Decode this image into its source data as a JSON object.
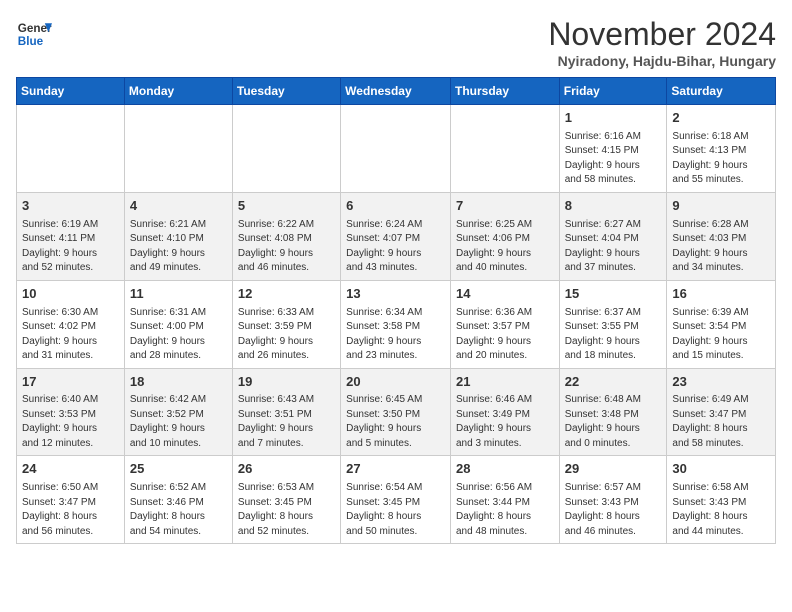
{
  "logo": {
    "line1": "General",
    "line2": "Blue"
  },
  "title": "November 2024",
  "location": "Nyiradony, Hajdu-Bihar, Hungary",
  "days_header": [
    "Sunday",
    "Monday",
    "Tuesday",
    "Wednesday",
    "Thursday",
    "Friday",
    "Saturday"
  ],
  "weeks": [
    [
      {
        "day": "",
        "info": ""
      },
      {
        "day": "",
        "info": ""
      },
      {
        "day": "",
        "info": ""
      },
      {
        "day": "",
        "info": ""
      },
      {
        "day": "",
        "info": ""
      },
      {
        "day": "1",
        "info": "Sunrise: 6:16 AM\nSunset: 4:15 PM\nDaylight: 9 hours\nand 58 minutes."
      },
      {
        "day": "2",
        "info": "Sunrise: 6:18 AM\nSunset: 4:13 PM\nDaylight: 9 hours\nand 55 minutes."
      }
    ],
    [
      {
        "day": "3",
        "info": "Sunrise: 6:19 AM\nSunset: 4:11 PM\nDaylight: 9 hours\nand 52 minutes."
      },
      {
        "day": "4",
        "info": "Sunrise: 6:21 AM\nSunset: 4:10 PM\nDaylight: 9 hours\nand 49 minutes."
      },
      {
        "day": "5",
        "info": "Sunrise: 6:22 AM\nSunset: 4:08 PM\nDaylight: 9 hours\nand 46 minutes."
      },
      {
        "day": "6",
        "info": "Sunrise: 6:24 AM\nSunset: 4:07 PM\nDaylight: 9 hours\nand 43 minutes."
      },
      {
        "day": "7",
        "info": "Sunrise: 6:25 AM\nSunset: 4:06 PM\nDaylight: 9 hours\nand 40 minutes."
      },
      {
        "day": "8",
        "info": "Sunrise: 6:27 AM\nSunset: 4:04 PM\nDaylight: 9 hours\nand 37 minutes."
      },
      {
        "day": "9",
        "info": "Sunrise: 6:28 AM\nSunset: 4:03 PM\nDaylight: 9 hours\nand 34 minutes."
      }
    ],
    [
      {
        "day": "10",
        "info": "Sunrise: 6:30 AM\nSunset: 4:02 PM\nDaylight: 9 hours\nand 31 minutes."
      },
      {
        "day": "11",
        "info": "Sunrise: 6:31 AM\nSunset: 4:00 PM\nDaylight: 9 hours\nand 28 minutes."
      },
      {
        "day": "12",
        "info": "Sunrise: 6:33 AM\nSunset: 3:59 PM\nDaylight: 9 hours\nand 26 minutes."
      },
      {
        "day": "13",
        "info": "Sunrise: 6:34 AM\nSunset: 3:58 PM\nDaylight: 9 hours\nand 23 minutes."
      },
      {
        "day": "14",
        "info": "Sunrise: 6:36 AM\nSunset: 3:57 PM\nDaylight: 9 hours\nand 20 minutes."
      },
      {
        "day": "15",
        "info": "Sunrise: 6:37 AM\nSunset: 3:55 PM\nDaylight: 9 hours\nand 18 minutes."
      },
      {
        "day": "16",
        "info": "Sunrise: 6:39 AM\nSunset: 3:54 PM\nDaylight: 9 hours\nand 15 minutes."
      }
    ],
    [
      {
        "day": "17",
        "info": "Sunrise: 6:40 AM\nSunset: 3:53 PM\nDaylight: 9 hours\nand 12 minutes."
      },
      {
        "day": "18",
        "info": "Sunrise: 6:42 AM\nSunset: 3:52 PM\nDaylight: 9 hours\nand 10 minutes."
      },
      {
        "day": "19",
        "info": "Sunrise: 6:43 AM\nSunset: 3:51 PM\nDaylight: 9 hours\nand 7 minutes."
      },
      {
        "day": "20",
        "info": "Sunrise: 6:45 AM\nSunset: 3:50 PM\nDaylight: 9 hours\nand 5 minutes."
      },
      {
        "day": "21",
        "info": "Sunrise: 6:46 AM\nSunset: 3:49 PM\nDaylight: 9 hours\nand 3 minutes."
      },
      {
        "day": "22",
        "info": "Sunrise: 6:48 AM\nSunset: 3:48 PM\nDaylight: 9 hours\nand 0 minutes."
      },
      {
        "day": "23",
        "info": "Sunrise: 6:49 AM\nSunset: 3:47 PM\nDaylight: 8 hours\nand 58 minutes."
      }
    ],
    [
      {
        "day": "24",
        "info": "Sunrise: 6:50 AM\nSunset: 3:47 PM\nDaylight: 8 hours\nand 56 minutes."
      },
      {
        "day": "25",
        "info": "Sunrise: 6:52 AM\nSunset: 3:46 PM\nDaylight: 8 hours\nand 54 minutes."
      },
      {
        "day": "26",
        "info": "Sunrise: 6:53 AM\nSunset: 3:45 PM\nDaylight: 8 hours\nand 52 minutes."
      },
      {
        "day": "27",
        "info": "Sunrise: 6:54 AM\nSunset: 3:45 PM\nDaylight: 8 hours\nand 50 minutes."
      },
      {
        "day": "28",
        "info": "Sunrise: 6:56 AM\nSunset: 3:44 PM\nDaylight: 8 hours\nand 48 minutes."
      },
      {
        "day": "29",
        "info": "Sunrise: 6:57 AM\nSunset: 3:43 PM\nDaylight: 8 hours\nand 46 minutes."
      },
      {
        "day": "30",
        "info": "Sunrise: 6:58 AM\nSunset: 3:43 PM\nDaylight: 8 hours\nand 44 minutes."
      }
    ]
  ]
}
